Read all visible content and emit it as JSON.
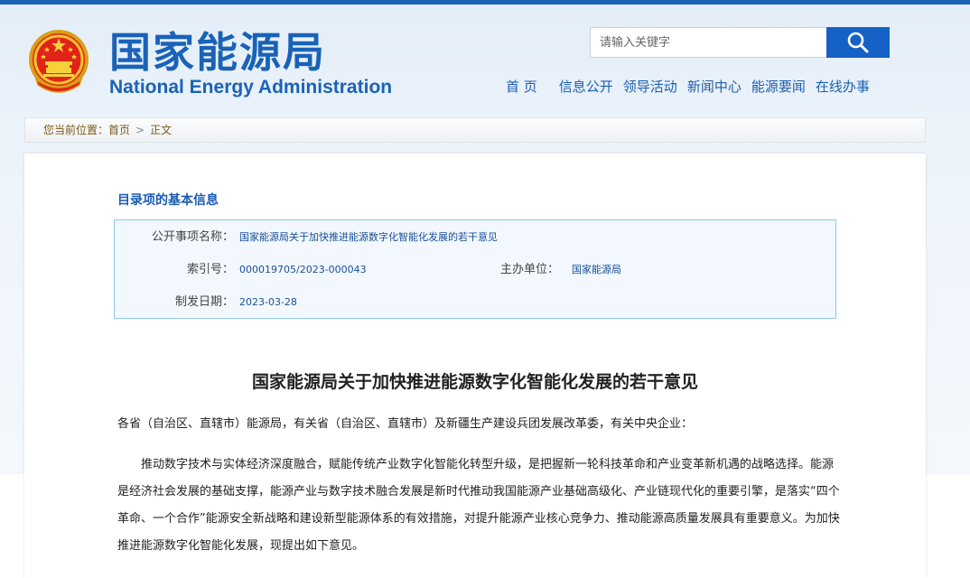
{
  "header": {
    "logo_cn": "国家能源局",
    "logo_en": "National Energy Administration",
    "search": {
      "placeholder": "请输入关键字",
      "button_icon": "search-icon"
    },
    "nav": [
      "首 页",
      "信息公开",
      "领导活动",
      "新闻中心",
      "能源要闻",
      "在线办事"
    ]
  },
  "breadcrumb": {
    "prefix": "您当前位置：",
    "home": "首页",
    "separator": ">",
    "current": "正文"
  },
  "info": {
    "section_title": "目录项的基本信息",
    "name_label": "公开事项名称：",
    "name_value": "国家能源局关于加快推进能源数字化智能化发展的若干意见",
    "index_label": "索引号：",
    "index_value": "000019705/2023-000043",
    "unit_label": "主办单位：",
    "unit_value": "国家能源局",
    "date_label": "制发日期：",
    "date_value": "2023-03-28"
  },
  "article": {
    "title": "国家能源局关于加快推进能源数字化智能化发展的若干意见",
    "addressee": "各省（自治区、直辖市）能源局，有关省（自治区、直辖市）及新疆生产建设兵团发展改革委，有关中央企业：",
    "paragraph1": "推动数字技术与实体经济深度融合，赋能传统产业数字化智能化转型升级，是把握新一轮科技革命和产业变革新机遇的战略选择。能源是经济社会发展的基础支撑，能源产业与数字技术融合发展是新时代推动我国能源产业基础高级化、产业链现代化的重要引擎，是落实“四个革命、一个合作”能源安全新战略和建设新型能源体系的有效措施，对提升能源产业核心竞争力、推动能源高质量发展具有重要意义。为加快推进能源数字化智能化发展，现提出如下意见。"
  },
  "colors": {
    "brand_blue": "#1a62b8",
    "search_button": "#1661c5",
    "crumb_text": "#7a5b16",
    "info_border": "#8fc9e8"
  }
}
